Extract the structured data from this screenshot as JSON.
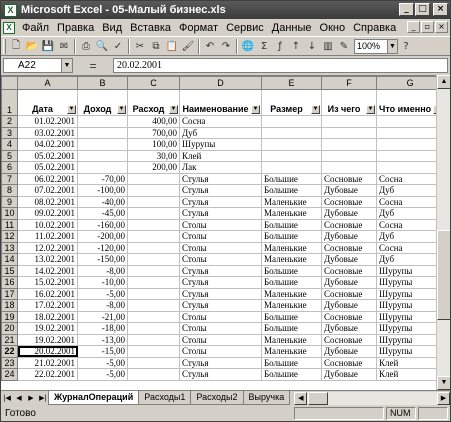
{
  "window": {
    "title": "Microsoft Excel - 05-Малый бизнес.xls"
  },
  "menu": [
    {
      "label": "Файл"
    },
    {
      "label": "Правка"
    },
    {
      "label": "Вид"
    },
    {
      "label": "Вставка"
    },
    {
      "label": "Формат"
    },
    {
      "label": "Сервис"
    },
    {
      "label": "Данные"
    },
    {
      "label": "Окно"
    },
    {
      "label": "Справка"
    }
  ],
  "toolbar": {
    "zoom": "100%"
  },
  "formula_bar": {
    "cell": "A22",
    "value": "20.02.2001"
  },
  "columns": [
    "A",
    "B",
    "C",
    "D",
    "E",
    "F",
    "G"
  ],
  "headers": [
    "Дата",
    "Доход",
    "Расход",
    "Наименование",
    "Размер",
    "Из чего",
    "Что именно"
  ],
  "rows": [
    {
      "n": "2",
      "c": [
        "01.02.2001",
        "",
        "400,00",
        "Сосна",
        "",
        "",
        ""
      ]
    },
    {
      "n": "3",
      "c": [
        "03.02.2001",
        "",
        "700,00",
        "Дуб",
        "",
        "",
        ""
      ]
    },
    {
      "n": "4",
      "c": [
        "04.02.2001",
        "",
        "100,00",
        "Шурупы",
        "",
        "",
        ""
      ]
    },
    {
      "n": "5",
      "c": [
        "05.02.2001",
        "",
        "30,00",
        "Клей",
        "",
        "",
        ""
      ]
    },
    {
      "n": "6",
      "c": [
        "05.02.2001",
        "",
        "200,00",
        "Лак",
        "",
        "",
        ""
      ]
    },
    {
      "n": "7",
      "c": [
        "06.02.2001",
        "-70,00",
        "",
        "Стулья",
        "Большие",
        "Сосновые",
        "Сосна"
      ]
    },
    {
      "n": "8",
      "c": [
        "07.02.2001",
        "-100,00",
        "",
        "Стулья",
        "Большие",
        "Дубовые",
        "Дуб"
      ]
    },
    {
      "n": "9",
      "c": [
        "08.02.2001",
        "-40,00",
        "",
        "Стулья",
        "Маленькие",
        "Сосновые",
        "Сосна"
      ]
    },
    {
      "n": "10",
      "c": [
        "09.02.2001",
        "-45,00",
        "",
        "Стулья",
        "Маленькие",
        "Дубовые",
        "Дуб"
      ]
    },
    {
      "n": "11",
      "c": [
        "10.02.2001",
        "-160,00",
        "",
        "Столы",
        "Большие",
        "Сосновые",
        "Сосна"
      ]
    },
    {
      "n": "12",
      "c": [
        "11.02.2001",
        "-200,00",
        "",
        "Столы",
        "Большие",
        "Дубовые",
        "Дуб"
      ]
    },
    {
      "n": "13",
      "c": [
        "12.02.2001",
        "-120,00",
        "",
        "Столы",
        "Маленькие",
        "Сосновые",
        "Сосна"
      ]
    },
    {
      "n": "14",
      "c": [
        "13.02.2001",
        "-150,00",
        "",
        "Столы",
        "Маленькие",
        "Дубовые",
        "Дуб"
      ]
    },
    {
      "n": "15",
      "c": [
        "14.02.2001",
        "-8,00",
        "",
        "Стулья",
        "Большие",
        "Сосновые",
        "Шурупы"
      ]
    },
    {
      "n": "16",
      "c": [
        "15.02.2001",
        "-10,00",
        "",
        "Стулья",
        "Большие",
        "Дубовые",
        "Шурупы"
      ]
    },
    {
      "n": "17",
      "c": [
        "16.02.2001",
        "-5,00",
        "",
        "Стулья",
        "Маленькие",
        "Сосновые",
        "Шурупы"
      ]
    },
    {
      "n": "18",
      "c": [
        "17.02.2001",
        "-8,00",
        "",
        "Стулья",
        "Маленькие",
        "Дубовые",
        "Шурупы"
      ]
    },
    {
      "n": "19",
      "c": [
        "18.02.2001",
        "-21,00",
        "",
        "Столы",
        "Большие",
        "Сосновые",
        "Шурупы"
      ]
    },
    {
      "n": "20",
      "c": [
        "19.02.2001",
        "-18,00",
        "",
        "Столы",
        "Большие",
        "Дубовые",
        "Шурупы"
      ]
    },
    {
      "n": "21",
      "c": [
        "19.02.2001",
        "-13,00",
        "",
        "Столы",
        "Маленькие",
        "Сосновые",
        "Шурупы"
      ]
    },
    {
      "n": "22",
      "c": [
        "20.02.2001",
        "-15,00",
        "",
        "Столы",
        "Маленькие",
        "Дубовые",
        "Шурупы"
      ]
    },
    {
      "n": "23",
      "c": [
        "21.02.2001",
        "-5,00",
        "",
        "Стулья",
        "Большие",
        "Сосновые",
        "Клей"
      ]
    },
    {
      "n": "24",
      "c": [
        "22.02.2001",
        "-5,00",
        "",
        "Стулья",
        "Большие",
        "Дубовые",
        "Клей"
      ]
    }
  ],
  "sheet_tabs": [
    {
      "label": "ЖурналОпераций",
      "active": true
    },
    {
      "label": "Расходы1",
      "active": false
    },
    {
      "label": "Расходы2",
      "active": false
    },
    {
      "label": "Выручка",
      "active": false
    }
  ],
  "status": {
    "text": "Готово",
    "num": "NUM"
  }
}
